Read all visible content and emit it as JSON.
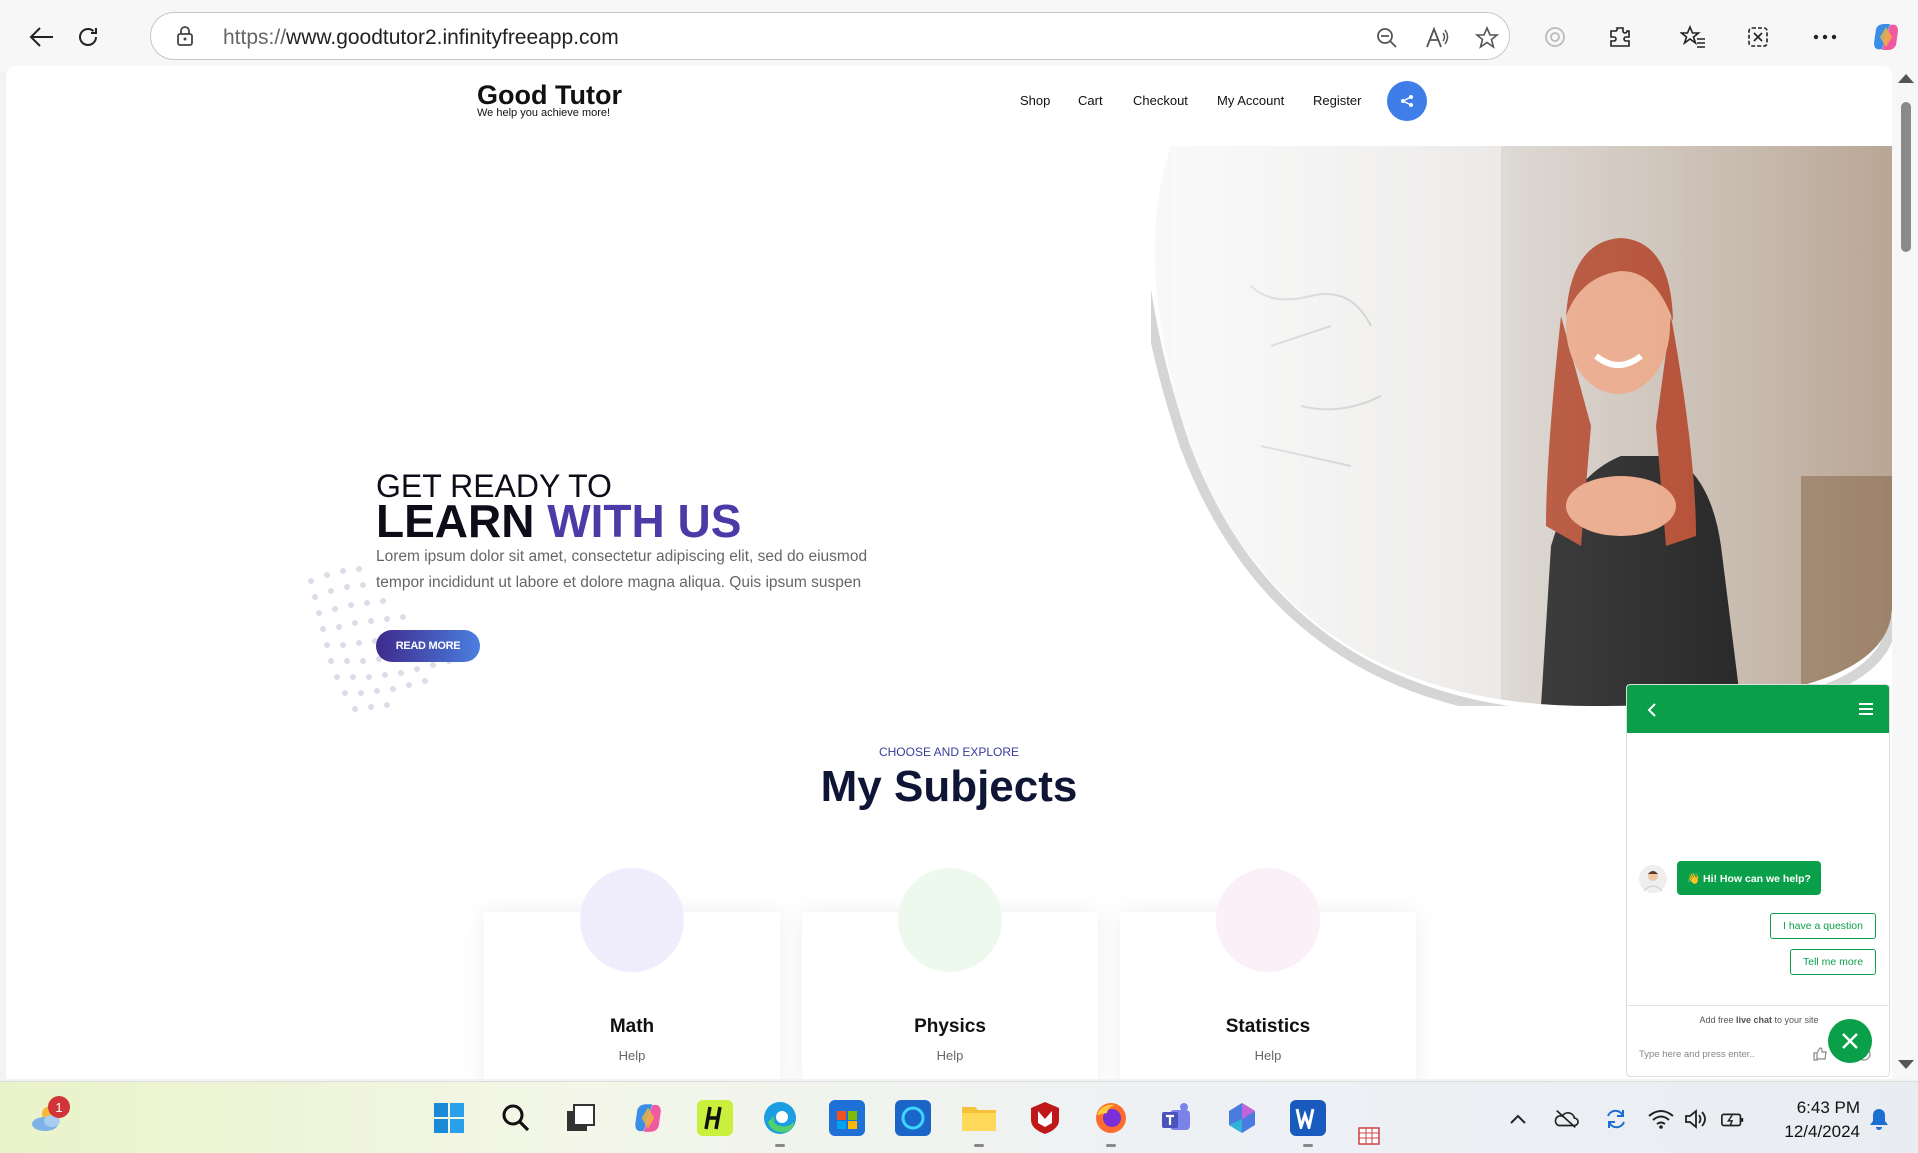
{
  "browser": {
    "url_scheme": "https://",
    "url_host": "www.goodtutor2.infinityfreeapp.com"
  },
  "site": {
    "logo_title": "Good Tutor",
    "logo_tagline": "We help you achieve more!",
    "nav": [
      "Shop",
      "Cart",
      "Checkout",
      "My Account",
      "Register"
    ]
  },
  "hero": {
    "line1": "GET READY TO",
    "line2_dark": "LEARN",
    "line2_accent": "WITH US",
    "paragraph": "Lorem ipsum dolor sit amet, consectetur adipiscing elit, sed do eiusmod tempor incididunt ut labore et dolore magna aliqua. Quis ipsum suspen",
    "button": "READ MORE"
  },
  "subjects": {
    "kicker": "CHOOSE AND EXPLORE",
    "title": "My Subjects",
    "cards": [
      {
        "title": "Math",
        "sub": "Help",
        "circle": "#efedfb"
      },
      {
        "title": "Physics",
        "sub": "Help",
        "circle": "#eef9ee"
      },
      {
        "title": "Statistics",
        "sub": "Help",
        "circle": "#fcf0f8"
      }
    ]
  },
  "chat": {
    "greeting": "👋 Hi! How can we help?",
    "options": [
      "I have a question",
      "Tell me more"
    ],
    "promo_prefix": "Add free",
    "promo_bold": "live chat",
    "promo_suffix": "to your site",
    "input_placeholder": "Type here and press enter.."
  },
  "taskbar": {
    "weather_badge": "1",
    "time": "6:43 PM",
    "date": "12/4/2024"
  },
  "colors": {
    "accent": "#4b3aa8",
    "chat_green": "#0aa04a",
    "share_blue": "#3f7ee8"
  }
}
